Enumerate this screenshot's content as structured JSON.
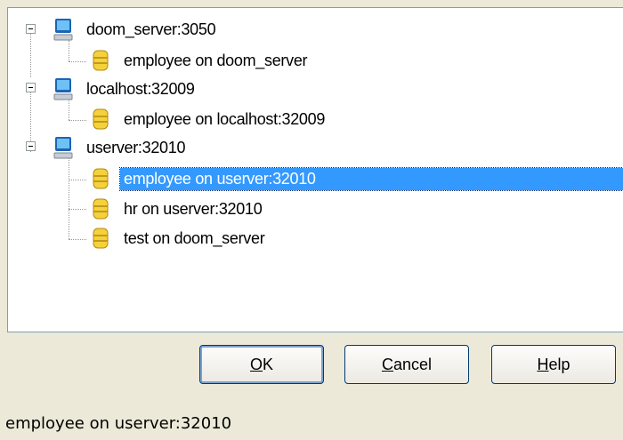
{
  "tree": {
    "servers": [
      {
        "label": "doom_server:3050",
        "icon": "computer-icon",
        "expanded": true,
        "databases": [
          {
            "label": "employee on doom_server",
            "icon": "database-icon",
            "selected": false
          }
        ]
      },
      {
        "label": "localhost:32009",
        "icon": "computer-icon",
        "expanded": true,
        "databases": [
          {
            "label": "employee on localhost:32009",
            "icon": "database-icon",
            "selected": false
          }
        ]
      },
      {
        "label": "userver:32010",
        "icon": "computer-icon",
        "expanded": true,
        "databases": [
          {
            "label": "employee on userver:32010",
            "icon": "database-icon",
            "selected": true
          },
          {
            "label": "hr on userver:32010",
            "icon": "database-icon",
            "selected": false
          },
          {
            "label": "test on doom_server",
            "icon": "database-icon",
            "selected": false
          }
        ]
      }
    ]
  },
  "buttons": {
    "ok": {
      "mnemonic": "O",
      "rest": "K"
    },
    "cancel": {
      "mnemonic": "C",
      "rest": "ancel"
    },
    "help": {
      "mnemonic": "H",
      "rest": "elp"
    }
  },
  "status_bar": {
    "text": "employee on userver:32010"
  },
  "colors": {
    "selection": "#3399ff",
    "dialog_bg": "#ece9d8",
    "button_border": "#003c74"
  }
}
